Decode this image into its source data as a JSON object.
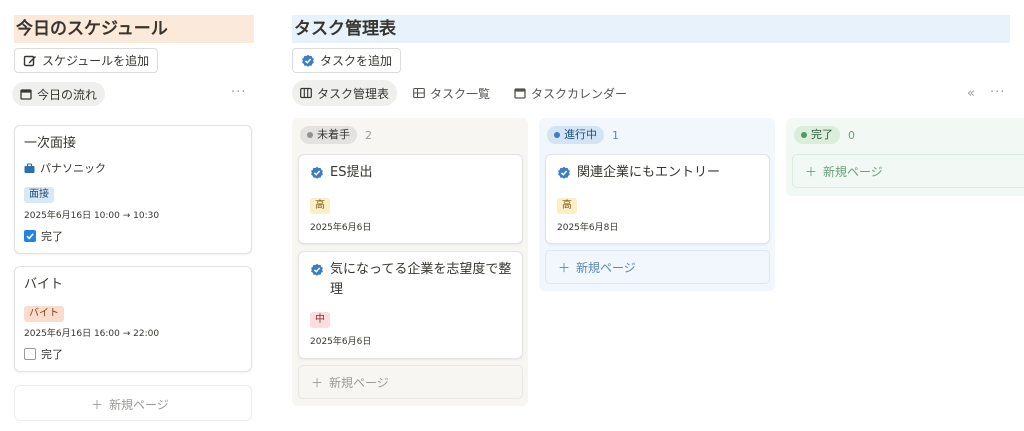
{
  "schedule": {
    "title": "今日のスケジュール",
    "add_button": "スケジュールを追加",
    "view_label": "今日の流れ",
    "more": "···",
    "cards": [
      {
        "title": "一次面接",
        "company": "パナソニック",
        "tag": "面接",
        "datetime": "2025年6月16日 10:00 → 10:30",
        "check_label": "完了",
        "checked": true
      },
      {
        "title": "バイト",
        "tag": "バイト",
        "datetime": "2025年6月16日 16:00 → 22:00",
        "check_label": "完了",
        "checked": false
      }
    ],
    "new_page": "新規ページ"
  },
  "tasks": {
    "title": "タスク管理表",
    "add_button": "タスクを追加",
    "tabs": [
      {
        "label": "タスク管理表",
        "icon": "board-icon",
        "active": true
      },
      {
        "label": "タスク一覧",
        "icon": "table-icon",
        "active": false
      },
      {
        "label": "タスクカレンダー",
        "icon": "calendar-icon",
        "active": false
      }
    ],
    "collapse": "«",
    "more": "···",
    "columns": [
      {
        "status": "未着手",
        "count": "2",
        "cards": [
          {
            "title": "ES提出",
            "priority": "高",
            "date": "2025年6月6日"
          },
          {
            "title": "気になってる企業を志望度で整理",
            "priority": "中",
            "date": "2025年6月6日"
          }
        ],
        "new_page": "新規ページ"
      },
      {
        "status": "進行中",
        "count": "1",
        "cards": [
          {
            "title": "関連企業にもエントリー",
            "priority": "高",
            "date": "2025年6月8日"
          }
        ],
        "new_page": "新規ページ"
      },
      {
        "status": "完了",
        "count": "0",
        "cards": [],
        "new_page": "新規ページ"
      }
    ]
  },
  "colors": {
    "left_header_bg": "#fbe9da",
    "right_header_bg": "#e8f2fb",
    "todo_col_bg": "#f7f6f3",
    "doing_col_bg": "#f1f7fc",
    "done_col_bg": "#f2f8f3",
    "check_blue": "#2383e2",
    "task_icon_blue": "#3a7ec2",
    "tag_interview_bg": "#d9e8f5",
    "tag_baito_bg": "#f9dccb",
    "priority_high_bg": "#fbefc8",
    "priority_mid_bg": "#fcdcdc"
  }
}
